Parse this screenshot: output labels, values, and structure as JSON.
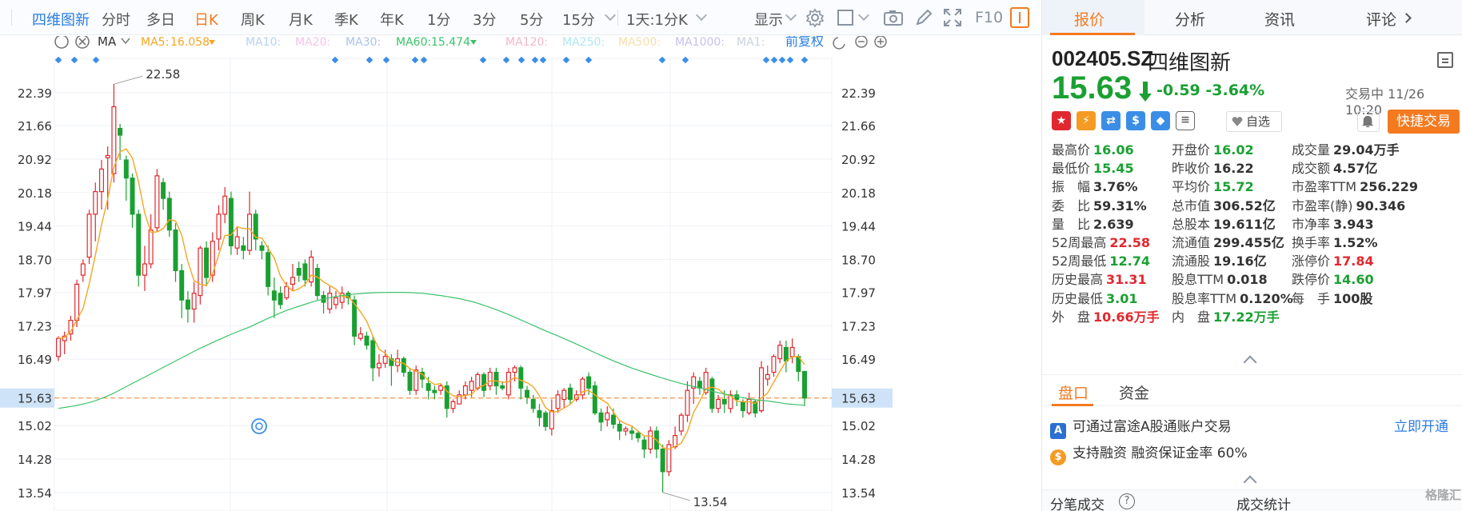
{
  "toolbar": {
    "stock_name": "四维图新",
    "periods": [
      "分时",
      "多日",
      "日K",
      "周K",
      "月K",
      "季K",
      "年K",
      "1分",
      "3分",
      "5分",
      "15分"
    ],
    "active_period": "日K",
    "multi_period_label": "1天:1分K",
    "display_label": "显示",
    "f10_label": "F10"
  },
  "indicator_bar": {
    "ma_label": "MA",
    "ma5": {
      "label": "MA5:",
      "value": "16.058"
    },
    "ma10": {
      "label": "MA10:"
    },
    "ma20": {
      "label": "MA20:"
    },
    "ma30": {
      "label": "MA30:"
    },
    "ma60": {
      "label": "MA60:",
      "value": "15.474"
    },
    "ma120": {
      "label": "MA120:"
    },
    "ma250": {
      "label": "MA250:"
    },
    "ma500": {
      "label": "MA500:"
    },
    "ma1000": {
      "label": "MA1000:"
    },
    "ma_extra": {
      "label": "MA1:"
    },
    "adjust_label": "前复权"
  },
  "colors": {
    "up": "#e0282e",
    "down": "#1aa032",
    "ma5": "#f5a623",
    "ma60": "#3cc26a",
    "accent": "#f47a20",
    "link": "#2a7de1"
  },
  "chart_data": {
    "type": "candlestick",
    "y_ticks": [
      "22.39",
      "21.66",
      "20.92",
      "20.18",
      "19.44",
      "18.70",
      "17.97",
      "17.23",
      "16.49",
      "15.63",
      "15.02",
      "14.28",
      "13.54"
    ],
    "ylim": [
      13.2,
      23.15
    ],
    "current_price": "15.63",
    "high_annotation": "22.58",
    "low_annotation": "13.54",
    "candles": [
      [
        16.55,
        16.95,
        16.45,
        17.0
      ],
      [
        16.9,
        17.0,
        16.6,
        17.1
      ],
      [
        17.05,
        17.35,
        16.9,
        17.45
      ],
      [
        17.35,
        18.15,
        17.2,
        18.25
      ],
      [
        18.35,
        18.6,
        18.2,
        18.7
      ],
      [
        18.75,
        19.7,
        18.6,
        19.8
      ],
      [
        19.7,
        20.2,
        19.1,
        20.4
      ],
      [
        20.2,
        20.7,
        19.8,
        20.9
      ],
      [
        20.95,
        21.0,
        19.8,
        21.2
      ],
      [
        20.6,
        22.08,
        20.4,
        22.58
      ],
      [
        21.6,
        21.45,
        20.9,
        21.7
      ],
      [
        20.9,
        20.5,
        20.0,
        21.0
      ],
      [
        20.5,
        19.7,
        19.4,
        20.6
      ],
      [
        19.7,
        18.35,
        18.1,
        19.8
      ],
      [
        18.35,
        18.6,
        18.0,
        19.0
      ],
      [
        18.6,
        19.35,
        18.5,
        19.7
      ],
      [
        19.4,
        20.55,
        19.3,
        20.7
      ],
      [
        20.4,
        20.05,
        19.8,
        20.5
      ],
      [
        20.05,
        19.35,
        19.2,
        20.2
      ],
      [
        19.35,
        18.45,
        18.2,
        19.5
      ],
      [
        18.45,
        17.8,
        17.4,
        18.6
      ],
      [
        17.8,
        17.6,
        17.3,
        18.0
      ],
      [
        17.6,
        17.95,
        17.3,
        18.2
      ],
      [
        17.9,
        18.95,
        17.7,
        19.0
      ],
      [
        18.95,
        18.3,
        18.1,
        19.1
      ],
      [
        18.35,
        19.1,
        18.2,
        19.3
      ],
      [
        19.15,
        19.7,
        18.9,
        19.9
      ],
      [
        19.7,
        20.1,
        19.5,
        20.3
      ],
      [
        20.05,
        19.0,
        18.8,
        20.2
      ],
      [
        18.95,
        19.2,
        18.8,
        19.4
      ],
      [
        19.0,
        18.9,
        18.7,
        19.2
      ],
      [
        18.9,
        19.7,
        18.8,
        20.2
      ],
      [
        19.7,
        19.15,
        18.9,
        19.8
      ],
      [
        19.0,
        18.9,
        18.7,
        19.1
      ],
      [
        18.85,
        18.1,
        17.9,
        19.0
      ],
      [
        18.0,
        17.8,
        17.4,
        18.3
      ],
      [
        17.95,
        17.7,
        17.6,
        18.1
      ],
      [
        17.85,
        18.1,
        17.8,
        18.2
      ],
      [
        18.15,
        18.3,
        18.0,
        18.6
      ],
      [
        18.5,
        18.35,
        18.2,
        18.65
      ],
      [
        18.6,
        18.25,
        18.1,
        18.7
      ],
      [
        18.2,
        18.75,
        18.1,
        18.9
      ],
      [
        18.5,
        17.9,
        17.8,
        18.6
      ],
      [
        17.9,
        17.75,
        17.5,
        18.0
      ],
      [
        17.6,
        17.95,
        17.5,
        18.1
      ],
      [
        17.7,
        17.85,
        17.6,
        18.0
      ],
      [
        17.75,
        17.95,
        17.6,
        18.1
      ],
      [
        17.95,
        17.85,
        17.7,
        18.0
      ],
      [
        17.8,
        17.0,
        16.8,
        17.9
      ],
      [
        16.95,
        17.05,
        16.9,
        17.2
      ],
      [
        17.0,
        16.8,
        16.7,
        17.1
      ],
      [
        16.9,
        16.3,
        16.0,
        17.0
      ],
      [
        16.3,
        16.4,
        16.1,
        16.6
      ],
      [
        16.4,
        16.55,
        16.3,
        16.7
      ],
      [
        16.5,
        16.35,
        15.9,
        16.6
      ],
      [
        16.35,
        16.5,
        16.2,
        16.7
      ],
      [
        16.5,
        16.2,
        16.1,
        16.55
      ],
      [
        16.2,
        15.8,
        15.7,
        16.3
      ],
      [
        15.8,
        16.25,
        15.7,
        16.35
      ],
      [
        16.2,
        16.05,
        15.85,
        16.3
      ],
      [
        15.95,
        15.8,
        15.6,
        16.1
      ],
      [
        15.8,
        15.75,
        15.6,
        15.9
      ],
      [
        15.8,
        15.9,
        15.7,
        15.95
      ],
      [
        15.9,
        15.4,
        15.2,
        16.0
      ],
      [
        15.4,
        15.55,
        15.3,
        15.6
      ],
      [
        15.5,
        15.7,
        15.5,
        15.8
      ],
      [
        15.7,
        15.9,
        15.6,
        16.0
      ],
      [
        15.8,
        16.0,
        15.65,
        16.1
      ],
      [
        15.85,
        16.15,
        15.8,
        16.2
      ],
      [
        16.15,
        15.8,
        15.65,
        16.2
      ],
      [
        15.9,
        16.2,
        15.8,
        16.3
      ],
      [
        16.2,
        15.9,
        15.7,
        16.3
      ],
      [
        15.9,
        15.85,
        15.8,
        16.0
      ],
      [
        15.7,
        16.2,
        15.6,
        16.3
      ],
      [
        16.2,
        16.3,
        16.0,
        16.35
      ],
      [
        16.3,
        15.85,
        15.6,
        16.35
      ],
      [
        15.8,
        15.65,
        15.5,
        15.9
      ],
      [
        15.6,
        15.4,
        15.3,
        15.7
      ],
      [
        15.35,
        15.2,
        15.0,
        15.5
      ],
      [
        15.3,
        15.0,
        14.9,
        15.35
      ],
      [
        14.95,
        15.35,
        14.8,
        15.6
      ],
      [
        15.4,
        15.7,
        15.3,
        15.8
      ],
      [
        15.6,
        15.8,
        15.4,
        15.85
      ],
      [
        15.85,
        15.6,
        15.5,
        15.95
      ],
      [
        15.6,
        15.7,
        15.55,
        15.8
      ],
      [
        15.7,
        16.05,
        15.6,
        16.1
      ],
      [
        16.1,
        15.85,
        15.7,
        16.2
      ],
      [
        15.9,
        15.3,
        15.25,
        16.0
      ],
      [
        15.3,
        15.1,
        14.9,
        15.4
      ],
      [
        15.15,
        15.3,
        15.0,
        15.45
      ],
      [
        15.25,
        15.05,
        14.95,
        15.4
      ],
      [
        15.05,
        14.9,
        14.7,
        15.15
      ],
      [
        14.9,
        14.95,
        14.8,
        15.0
      ],
      [
        14.9,
        14.85,
        14.7,
        15.0
      ],
      [
        14.85,
        14.75,
        14.65,
        14.9
      ],
      [
        14.7,
        14.5,
        14.3,
        14.8
      ],
      [
        14.5,
        14.9,
        14.4,
        15.0
      ],
      [
        14.9,
        14.5,
        14.3,
        15.0
      ],
      [
        14.5,
        14.0,
        13.54,
        14.6
      ],
      [
        14.0,
        14.6,
        13.9,
        14.7
      ],
      [
        14.55,
        14.8,
        14.5,
        15.0
      ],
      [
        14.9,
        15.25,
        14.8,
        15.3
      ],
      [
        15.25,
        15.8,
        15.1,
        16.0
      ],
      [
        15.85,
        16.1,
        15.5,
        16.2
      ],
      [
        16.0,
        15.85,
        15.7,
        16.1
      ],
      [
        15.75,
        16.2,
        15.7,
        16.3
      ],
      [
        16.05,
        15.4,
        15.3,
        16.1
      ],
      [
        15.4,
        15.6,
        15.3,
        15.7
      ],
      [
        15.6,
        15.5,
        15.3,
        15.8
      ],
      [
        15.4,
        15.7,
        15.3,
        15.8
      ],
      [
        15.7,
        15.6,
        15.45,
        15.8
      ],
      [
        15.55,
        15.35,
        15.2,
        15.6
      ],
      [
        15.3,
        15.6,
        15.25,
        15.75
      ],
      [
        15.55,
        15.3,
        15.2,
        15.6
      ],
      [
        15.35,
        16.3,
        15.3,
        16.45
      ],
      [
        16.05,
        16.15,
        15.9,
        16.35
      ],
      [
        16.2,
        16.55,
        16.1,
        16.6
      ],
      [
        16.5,
        16.8,
        16.4,
        16.9
      ],
      [
        16.75,
        16.45,
        16.2,
        16.9
      ],
      [
        16.55,
        16.75,
        16.4,
        16.95
      ],
      [
        16.55,
        16.22,
        16.0,
        16.6
      ],
      [
        16.22,
        15.63,
        15.45,
        16.06
      ]
    ],
    "ma5_start": 0,
    "ma60_values_start": [
      15.4,
      15.46,
      15.55,
      15.7,
      15.9,
      16.1,
      16.3,
      16.5,
      16.7,
      16.88,
      17.05,
      17.2,
      17.38,
      17.55,
      17.68,
      17.8,
      17.88,
      17.93,
      17.96,
      17.97,
      17.97,
      17.95,
      17.9,
      17.84,
      17.75,
      17.62,
      17.47,
      17.3,
      17.13,
      16.97,
      16.8,
      16.62,
      16.45,
      16.3,
      16.17,
      16.05,
      15.94,
      15.85,
      15.75,
      15.67,
      15.6,
      15.56,
      15.5,
      15.47
    ]
  },
  "right_panel": {
    "tabs": [
      "报价",
      "分析",
      "资讯",
      "评论"
    ],
    "active_tab": "报价",
    "code": "002405.SZ",
    "name": "四维图新",
    "price": "15.63",
    "change": "-0.59",
    "change_pct": "-3.64%",
    "status": "交易中 11/26 10:20",
    "watch_label": "自选",
    "quick_trade_label": "快捷交易",
    "quotes": [
      [
        {
          "label": "最高价",
          "value": "16.06",
          "color": "green"
        },
        {
          "label": "开盘价",
          "value": "16.02",
          "color": "green"
        },
        {
          "label": "成交量",
          "value": "29.04万手",
          "color": ""
        }
      ],
      [
        {
          "label": "最低价",
          "value": "15.45",
          "color": "green"
        },
        {
          "label": "昨收价",
          "value": "16.22",
          "color": ""
        },
        {
          "label": "成交额",
          "value": "4.57亿",
          "color": ""
        }
      ],
      [
        {
          "label": "振　幅",
          "value": "3.76%",
          "color": ""
        },
        {
          "label": "平均价",
          "value": "15.72",
          "color": "green"
        },
        {
          "label": "市盈率TTM",
          "value": "256.229",
          "color": ""
        }
      ],
      [
        {
          "label": "委　比",
          "value": "59.31%",
          "color": ""
        },
        {
          "label": "总市值",
          "value": "306.52亿",
          "color": ""
        },
        {
          "label": "市盈率(静)",
          "value": "90.346",
          "color": ""
        }
      ],
      [
        {
          "label": "量　比",
          "value": "2.639",
          "color": ""
        },
        {
          "label": "总股本",
          "value": "19.611亿",
          "color": ""
        },
        {
          "label": "市净率",
          "value": "3.943",
          "color": ""
        }
      ],
      [
        {
          "label": "52周最高",
          "value": "22.58",
          "color": "red"
        },
        {
          "label": "流通值",
          "value": "299.455亿",
          "color": ""
        },
        {
          "label": "换手率",
          "value": "1.52%",
          "color": ""
        }
      ],
      [
        {
          "label": "52周最低",
          "value": "12.74",
          "color": "green"
        },
        {
          "label": "流通股",
          "value": "19.16亿",
          "color": ""
        },
        {
          "label": "涨停价",
          "value": "17.84",
          "color": "red"
        }
      ],
      [
        {
          "label": "历史最高",
          "value": "31.31",
          "color": "red"
        },
        {
          "label": "股息TTM",
          "value": "0.018",
          "color": ""
        },
        {
          "label": "跌停价",
          "value": "14.60",
          "color": "green"
        }
      ],
      [
        {
          "label": "历史最低",
          "value": "3.01",
          "color": "green"
        },
        {
          "label": "股息率TTM",
          "value": "0.120%",
          "color": ""
        },
        {
          "label": "每　手",
          "value": "100股",
          "color": ""
        }
      ],
      [
        {
          "label": "外　盘",
          "value": "10.66万手",
          "color": "red"
        },
        {
          "label": "内　盘",
          "value": "17.22万手",
          "color": "green"
        }
      ]
    ],
    "sub_tabs": [
      "盘口",
      "资金"
    ],
    "active_sub_tab": "盘口",
    "info_a": "可通过富途A股通账户交易",
    "open_link": "立即开通",
    "info_margin": "支持融资  融资保证金率 60%",
    "tick_label": "分笔成交",
    "stats_label": "成交统计",
    "watermark": "格隆汇"
  }
}
